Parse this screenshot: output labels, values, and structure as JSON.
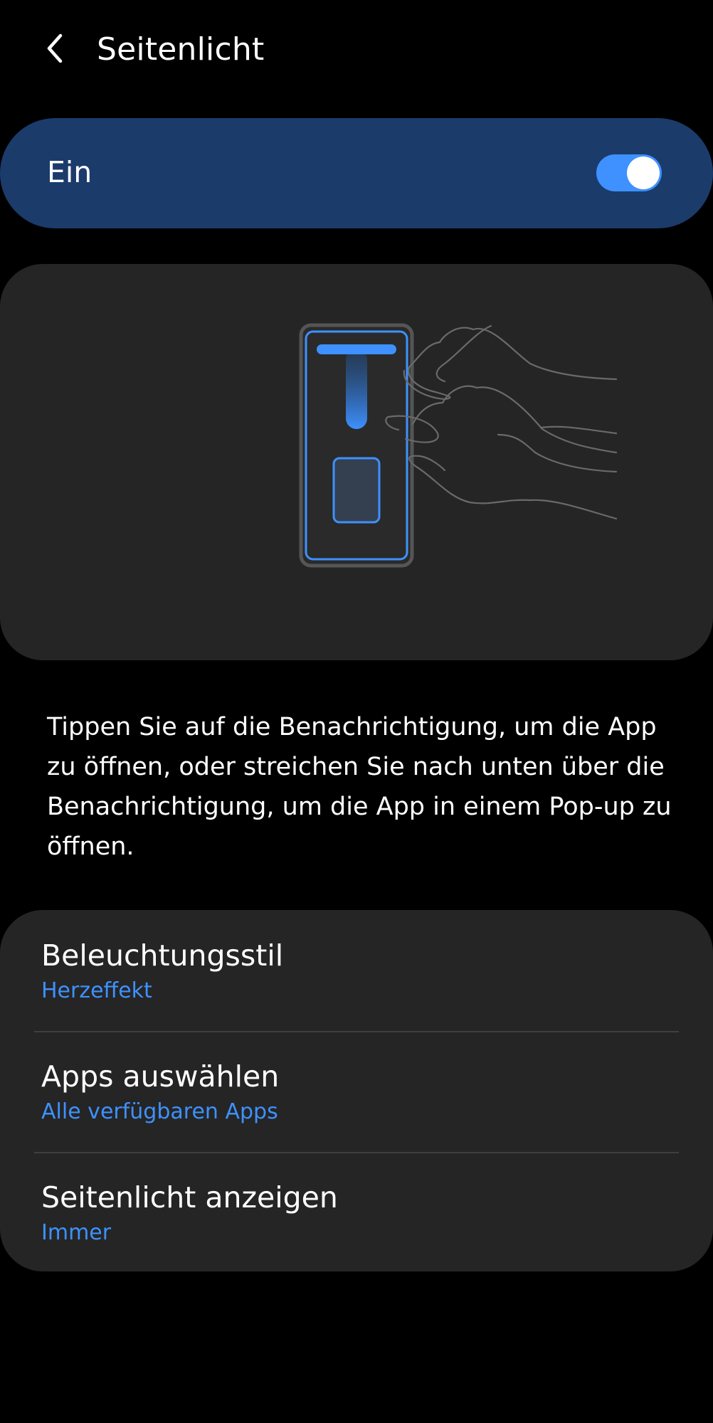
{
  "header": {
    "back_icon": "chevron-left-icon",
    "title": "Seitenlicht"
  },
  "master_switch": {
    "label": "Ein",
    "enabled": true,
    "accent_color": "#3e91ff",
    "background_color": "#1b3b6b"
  },
  "illustration": {
    "icon": "edge-lighting-gesture-illustration"
  },
  "description": {
    "text": "Tippen Sie auf die Benachrichtigung, um die App zu öffnen, oder streichen Sie nach unten über die Benachrichtigung, um die App in einem Pop-up zu öffnen."
  },
  "settings": {
    "items": [
      {
        "title": "Beleuchtungsstil",
        "value": "Herzeffekt"
      },
      {
        "title": "Apps auswählen",
        "value": "Alle verfügbaren Apps"
      },
      {
        "title": "Seitenlicht anzeigen",
        "value": "Immer"
      }
    ]
  },
  "colors": {
    "background": "#000000",
    "card": "#252525",
    "accent": "#3e91ff",
    "divider": "#3f3f3f"
  }
}
